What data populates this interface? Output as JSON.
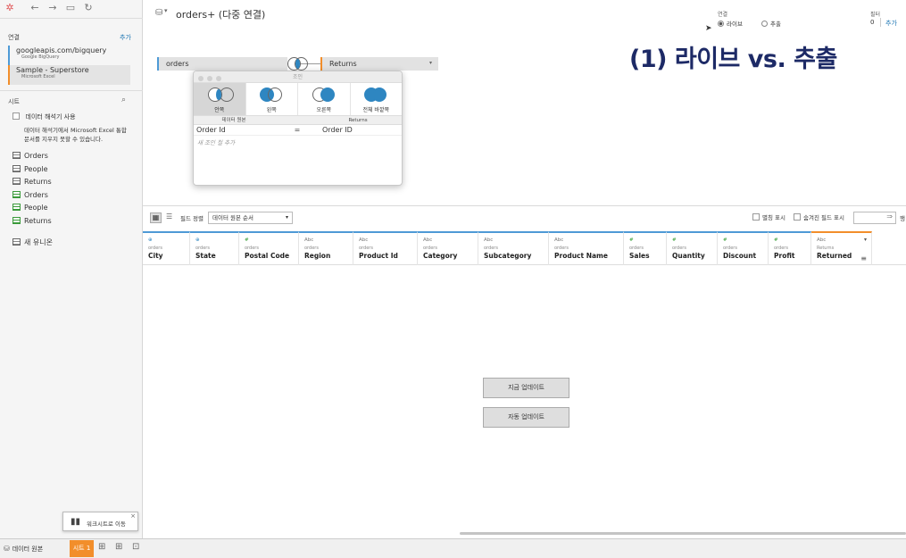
{
  "toolbar": {
    "icons": [
      "tableau-logo-icon",
      "back-arrow-icon",
      "forward-arrow-icon",
      "save-icon",
      "refresh-icon"
    ]
  },
  "sidebar": {
    "connections_header": "연결",
    "add_link": "추가",
    "connections": [
      {
        "name": "googleapis.com/bigquery",
        "sub": "Google BigQuery"
      },
      {
        "name": "Sample - Superstore",
        "sub": "Microsoft Excel"
      }
    ],
    "sheets_header": "시트",
    "interpreter_label": "데이터 해석기 사용",
    "interpreter_desc": "데이터 해석기에서 Microsoft Excel 통합 문서를 지우지 못할 수 있습니다.",
    "sheets": [
      {
        "name": "Orders",
        "icon": "table-icon"
      },
      {
        "name": "People",
        "icon": "table-icon"
      },
      {
        "name": "Returns",
        "icon": "table-icon"
      },
      {
        "name": "Orders",
        "icon": "named-range-icon"
      },
      {
        "name": "People",
        "icon": "named-range-icon"
      },
      {
        "name": "Returns",
        "icon": "named-range-icon"
      }
    ],
    "new_union": "새 유니온"
  },
  "header": {
    "datasource_title": "orders+ (다중 연결)",
    "connection_label": "연결",
    "live_label": "라이브",
    "extract_label": "추출",
    "filter_label": "필터",
    "filter_count": "0",
    "filter_add": "추가",
    "overlay_title": "(1) 라이브 vs. 추출"
  },
  "canvas": {
    "left_table": "orders",
    "right_table": "Returns"
  },
  "join_dialog": {
    "title": "조인",
    "types": [
      "안쪽",
      "왼쪽",
      "오른쪽",
      "전체 바깥쪽"
    ],
    "left_col_header": "데이터 원본",
    "right_col_header": "Returns",
    "left_field": "Order Id",
    "operator": "=",
    "right_field": "Order ID",
    "add_clause": "새 조인 절 추가"
  },
  "field_toolbar": {
    "sort_label": "필드 정렬",
    "sort_value": "데이터 원본 순서",
    "show_aliases": "별칭 표시",
    "show_hidden": "숨겨진 필드 표시",
    "rows_label": "행"
  },
  "grid": {
    "columns": [
      {
        "type": "⊕",
        "src": "orders",
        "name": "City"
      },
      {
        "type": "⊕",
        "src": "orders",
        "name": "State"
      },
      {
        "type": "#",
        "src": "orders",
        "name": "Postal Code"
      },
      {
        "type": "Abc",
        "src": "orders",
        "name": "Region"
      },
      {
        "type": "Abc",
        "src": "orders",
        "name": "Product Id"
      },
      {
        "type": "Abc",
        "src": "orders",
        "name": "Category"
      },
      {
        "type": "Abc",
        "src": "orders",
        "name": "Subcategory"
      },
      {
        "type": "Abc",
        "src": "orders",
        "name": "Product Name"
      },
      {
        "type": "#",
        "src": "orders",
        "name": "Sales"
      },
      {
        "type": "#",
        "src": "orders",
        "name": "Quantity"
      },
      {
        "type": "#",
        "src": "orders",
        "name": "Discount"
      },
      {
        "type": "#",
        "src": "orders",
        "name": "Profit"
      },
      {
        "type": "Abc",
        "src": "Returns",
        "name": "Returned"
      }
    ],
    "update_now": "지금 업데이트",
    "auto_update": "자동 업데이트"
  },
  "bottom": {
    "datasource_tab": "데이터 원본",
    "sheet_tab": "시트 1",
    "goto_worksheet": "워크시트로 이동"
  },
  "colors": {
    "accent_blue": "#4e9ad6",
    "accent_orange": "#f28e2b",
    "title_navy": "#1d2a66",
    "join_fill": "#2e86c1"
  }
}
